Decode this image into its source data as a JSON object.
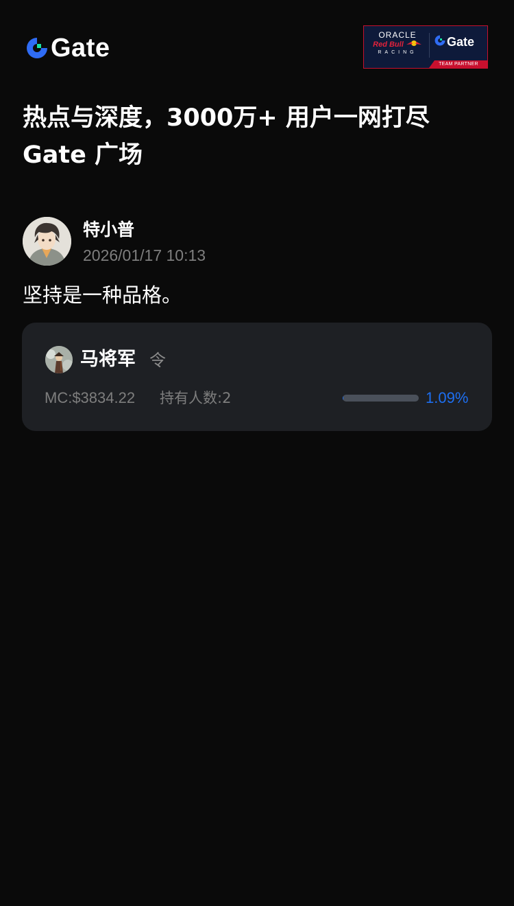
{
  "header": {
    "logo_text": "Gate",
    "partner_badge": {
      "oracle": "ORACLE",
      "redbull": "Red Bull",
      "racing": "RACING",
      "gate": "Gate",
      "footer": "TEAM PARTNER"
    }
  },
  "headline": {
    "line1": "热点与深度，3000万+ 用户一网打尽",
    "line2": "Gate 广场"
  },
  "post": {
    "author": "特小普",
    "time": "2026/01/17 10:13",
    "content": "坚持是一种品格。"
  },
  "token_card": {
    "name": "马将军",
    "symbol": "令",
    "market_cap": "MC:$3834.22",
    "holders": "持有人数:2",
    "percent_text": "1.09%",
    "progress_fraction": 0.0109
  },
  "colors": {
    "background": "#0a0a0a",
    "card": "#1e2024",
    "accent_blue": "#1d6ff2",
    "logo_green": "#17e3a3",
    "muted_text": "#7e7e7e"
  },
  "icons": {
    "logo": "gate-logo-icon",
    "author_avatar": "user-avatar-image",
    "token_avatar": "token-avatar-image"
  }
}
